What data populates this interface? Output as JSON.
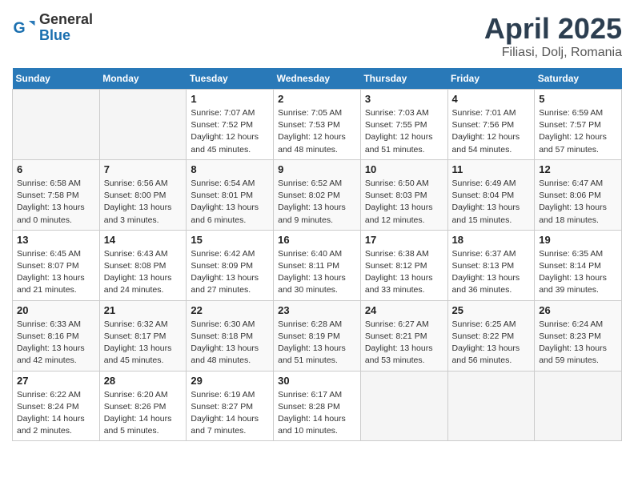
{
  "logo": {
    "line1": "General",
    "line2": "Blue"
  },
  "title": "April 2025",
  "subtitle": "Filiasi, Dolj, Romania",
  "weekdays": [
    "Sunday",
    "Monday",
    "Tuesday",
    "Wednesday",
    "Thursday",
    "Friday",
    "Saturday"
  ],
  "weeks": [
    [
      {
        "day": "",
        "info": ""
      },
      {
        "day": "",
        "info": ""
      },
      {
        "day": "1",
        "info": "Sunrise: 7:07 AM\nSunset: 7:52 PM\nDaylight: 12 hours and 45 minutes."
      },
      {
        "day": "2",
        "info": "Sunrise: 7:05 AM\nSunset: 7:53 PM\nDaylight: 12 hours and 48 minutes."
      },
      {
        "day": "3",
        "info": "Sunrise: 7:03 AM\nSunset: 7:55 PM\nDaylight: 12 hours and 51 minutes."
      },
      {
        "day": "4",
        "info": "Sunrise: 7:01 AM\nSunset: 7:56 PM\nDaylight: 12 hours and 54 minutes."
      },
      {
        "day": "5",
        "info": "Sunrise: 6:59 AM\nSunset: 7:57 PM\nDaylight: 12 hours and 57 minutes."
      }
    ],
    [
      {
        "day": "6",
        "info": "Sunrise: 6:58 AM\nSunset: 7:58 PM\nDaylight: 13 hours and 0 minutes."
      },
      {
        "day": "7",
        "info": "Sunrise: 6:56 AM\nSunset: 8:00 PM\nDaylight: 13 hours and 3 minutes."
      },
      {
        "day": "8",
        "info": "Sunrise: 6:54 AM\nSunset: 8:01 PM\nDaylight: 13 hours and 6 minutes."
      },
      {
        "day": "9",
        "info": "Sunrise: 6:52 AM\nSunset: 8:02 PM\nDaylight: 13 hours and 9 minutes."
      },
      {
        "day": "10",
        "info": "Sunrise: 6:50 AM\nSunset: 8:03 PM\nDaylight: 13 hours and 12 minutes."
      },
      {
        "day": "11",
        "info": "Sunrise: 6:49 AM\nSunset: 8:04 PM\nDaylight: 13 hours and 15 minutes."
      },
      {
        "day": "12",
        "info": "Sunrise: 6:47 AM\nSunset: 8:06 PM\nDaylight: 13 hours and 18 minutes."
      }
    ],
    [
      {
        "day": "13",
        "info": "Sunrise: 6:45 AM\nSunset: 8:07 PM\nDaylight: 13 hours and 21 minutes."
      },
      {
        "day": "14",
        "info": "Sunrise: 6:43 AM\nSunset: 8:08 PM\nDaylight: 13 hours and 24 minutes."
      },
      {
        "day": "15",
        "info": "Sunrise: 6:42 AM\nSunset: 8:09 PM\nDaylight: 13 hours and 27 minutes."
      },
      {
        "day": "16",
        "info": "Sunrise: 6:40 AM\nSunset: 8:11 PM\nDaylight: 13 hours and 30 minutes."
      },
      {
        "day": "17",
        "info": "Sunrise: 6:38 AM\nSunset: 8:12 PM\nDaylight: 13 hours and 33 minutes."
      },
      {
        "day": "18",
        "info": "Sunrise: 6:37 AM\nSunset: 8:13 PM\nDaylight: 13 hours and 36 minutes."
      },
      {
        "day": "19",
        "info": "Sunrise: 6:35 AM\nSunset: 8:14 PM\nDaylight: 13 hours and 39 minutes."
      }
    ],
    [
      {
        "day": "20",
        "info": "Sunrise: 6:33 AM\nSunset: 8:16 PM\nDaylight: 13 hours and 42 minutes."
      },
      {
        "day": "21",
        "info": "Sunrise: 6:32 AM\nSunset: 8:17 PM\nDaylight: 13 hours and 45 minutes."
      },
      {
        "day": "22",
        "info": "Sunrise: 6:30 AM\nSunset: 8:18 PM\nDaylight: 13 hours and 48 minutes."
      },
      {
        "day": "23",
        "info": "Sunrise: 6:28 AM\nSunset: 8:19 PM\nDaylight: 13 hours and 51 minutes."
      },
      {
        "day": "24",
        "info": "Sunrise: 6:27 AM\nSunset: 8:21 PM\nDaylight: 13 hours and 53 minutes."
      },
      {
        "day": "25",
        "info": "Sunrise: 6:25 AM\nSunset: 8:22 PM\nDaylight: 13 hours and 56 minutes."
      },
      {
        "day": "26",
        "info": "Sunrise: 6:24 AM\nSunset: 8:23 PM\nDaylight: 13 hours and 59 minutes."
      }
    ],
    [
      {
        "day": "27",
        "info": "Sunrise: 6:22 AM\nSunset: 8:24 PM\nDaylight: 14 hours and 2 minutes."
      },
      {
        "day": "28",
        "info": "Sunrise: 6:20 AM\nSunset: 8:26 PM\nDaylight: 14 hours and 5 minutes."
      },
      {
        "day": "29",
        "info": "Sunrise: 6:19 AM\nSunset: 8:27 PM\nDaylight: 14 hours and 7 minutes."
      },
      {
        "day": "30",
        "info": "Sunrise: 6:17 AM\nSunset: 8:28 PM\nDaylight: 14 hours and 10 minutes."
      },
      {
        "day": "",
        "info": ""
      },
      {
        "day": "",
        "info": ""
      },
      {
        "day": "",
        "info": ""
      }
    ]
  ]
}
